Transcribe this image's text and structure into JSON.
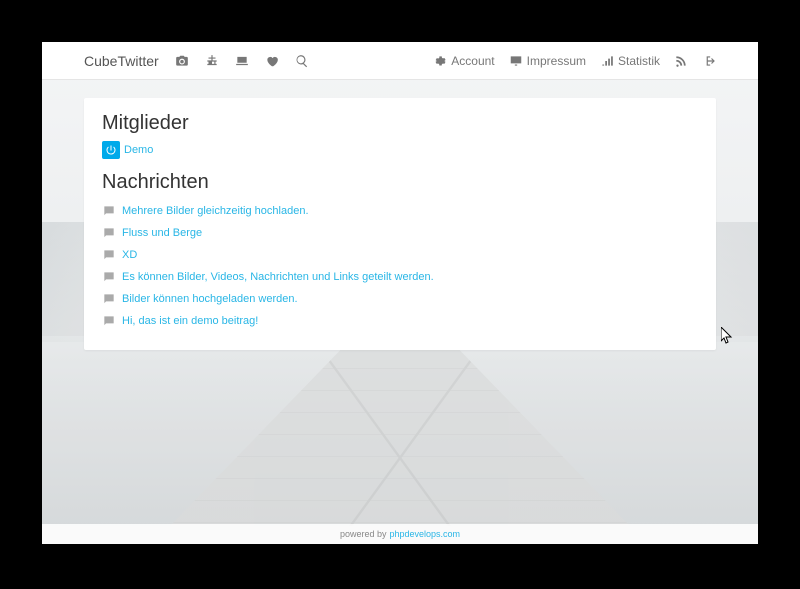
{
  "brand": "CubeTwitter",
  "nav": {
    "right": [
      {
        "label": "Account"
      },
      {
        "label": "Impressum"
      },
      {
        "label": "Statistik"
      }
    ]
  },
  "sections": {
    "members": {
      "title": "Mitglieder",
      "items": [
        {
          "name": "Demo"
        }
      ]
    },
    "messages": {
      "title": "Nachrichten",
      "items": [
        {
          "text": "Mehrere Bilder gleichzeitig hochladen."
        },
        {
          "text": "Fluss und Berge"
        },
        {
          "text": "XD"
        },
        {
          "text": "Es können Bilder, Videos, Nachrichten und Links geteilt werden."
        },
        {
          "text": "Bilder können hochgeladen werden."
        },
        {
          "text": "Hi, das ist ein demo beitrag!"
        }
      ]
    }
  },
  "footer": {
    "prefix": "powered by",
    "link": "phpdevelops.com"
  }
}
